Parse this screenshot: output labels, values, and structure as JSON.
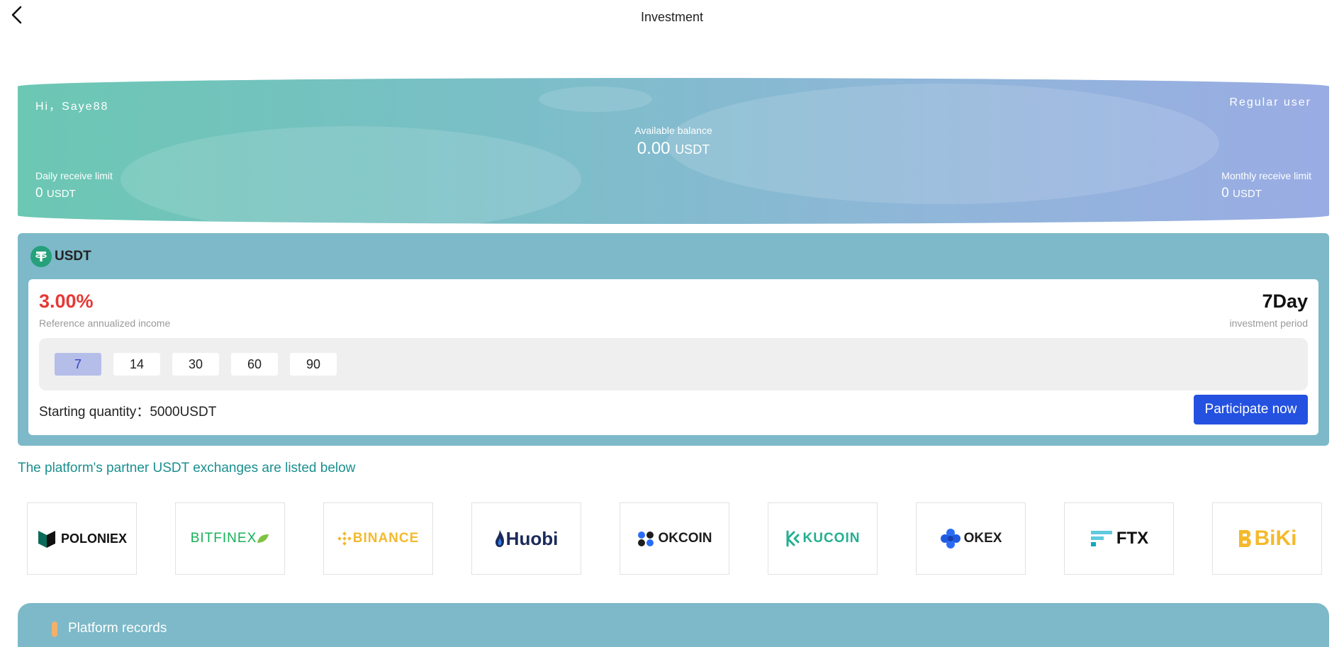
{
  "header": {
    "title": "Investment"
  },
  "balance": {
    "greeting": "Hi，Saye88",
    "user_level": "Regular user",
    "available_label": "Available balance",
    "available_value": "0.00",
    "available_unit": "USDT",
    "daily_label": "Daily receive limit",
    "daily_value": "0",
    "daily_unit": "USDT",
    "monthly_label": "Monthly receive limit",
    "monthly_value": "0",
    "monthly_unit": "USDT"
  },
  "product": {
    "coin": "USDT",
    "rate": "3.00%",
    "rate_label": "Reference annualized income",
    "period": "7Day",
    "period_label": "investment period",
    "day_options": [
      "7",
      "14",
      "30",
      "60",
      "90"
    ],
    "selected_day": "7",
    "starting_label": "Starting quantity：",
    "starting_value": "5000USDT",
    "participate_label": "Participate now"
  },
  "partners": {
    "title": "The platform's partner USDT exchanges are listed below",
    "exchanges": [
      {
        "name": "POLONIEX",
        "color": "#111111",
        "icon": "poloniex-icon"
      },
      {
        "name": "BITFINEX",
        "color": "#16b157",
        "icon": "bitfinex-leaf-icon"
      },
      {
        "name": "BINANCE",
        "color": "#f3ba2f",
        "icon": "binance-icon"
      },
      {
        "name": "Huobi",
        "color": "#1b2a5a",
        "icon": "huobi-flame-icon"
      },
      {
        "name": "OKCOIN",
        "color": "#1d1d1d",
        "icon": "okcoin-icon"
      },
      {
        "name": "KUCOIN",
        "color": "#23af91",
        "icon": "kucoin-icon"
      },
      {
        "name": "OKEX",
        "color": "#1d1d1d",
        "icon": "okex-icon"
      },
      {
        "name": "FTX",
        "color": "#11a9bc",
        "icon": "ftx-icon"
      },
      {
        "name": "BiKi",
        "color": "#f5b92a",
        "icon": "biki-icon"
      }
    ]
  },
  "records": {
    "title": "Platform records"
  }
}
